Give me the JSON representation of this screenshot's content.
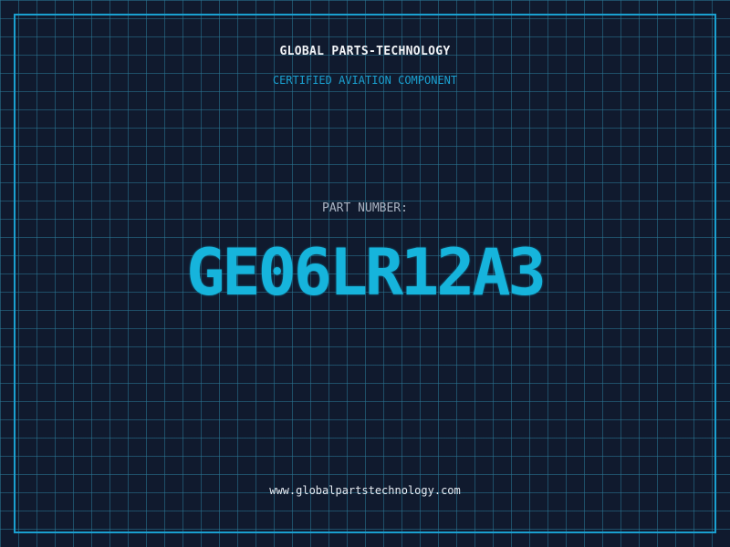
{
  "header": {
    "company": "GLOBAL PARTS-TECHNOLOGY",
    "subtitle": "CERTIFIED AVIATION COMPONENT"
  },
  "part": {
    "label": "PART NUMBER:",
    "number": "GE06LR12A3"
  },
  "footer": {
    "website": "www.globalpartstechnology.com"
  },
  "colors": {
    "background": "#101a2e",
    "grid": "#2b7896",
    "accent": "#1aa0d0",
    "part_number": "#16b4dc",
    "text": "#f2f4f7"
  }
}
